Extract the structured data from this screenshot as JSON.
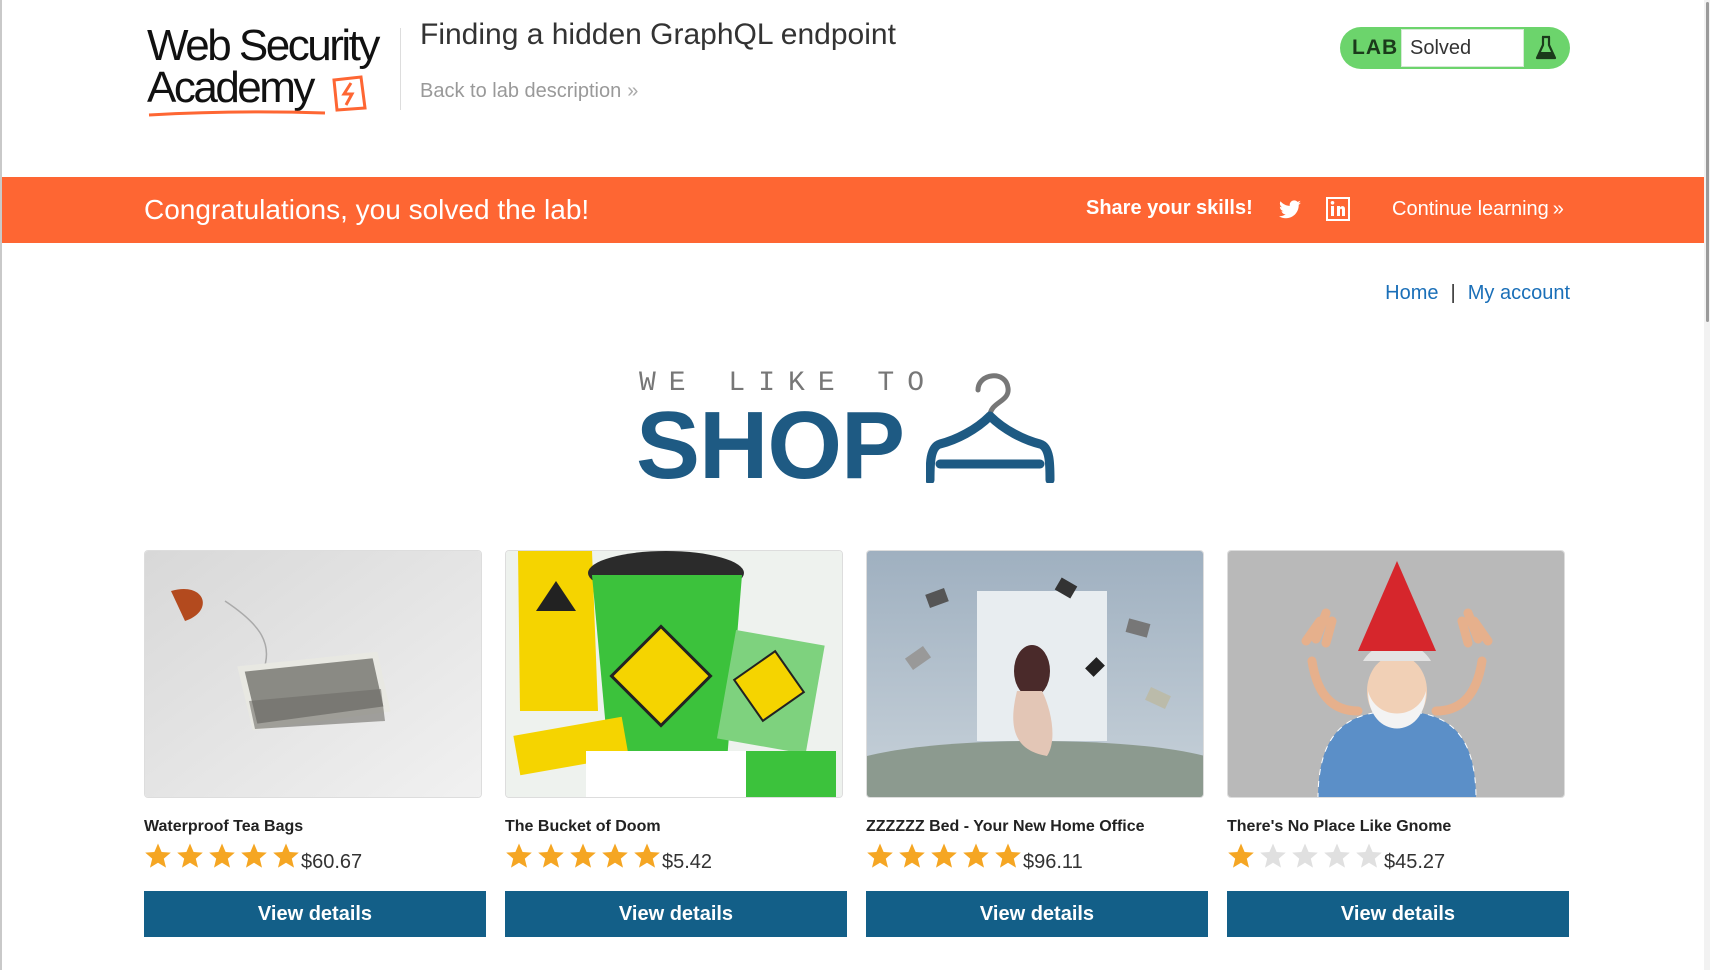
{
  "header": {
    "logo_line1": "Web Security",
    "logo_line2": "Academy",
    "lab_title": "Finding a hidden GraphQL endpoint",
    "back_link": "Back to lab description",
    "lab_badge": {
      "label": "LAB",
      "status": "Solved",
      "color": "#6cd46c"
    }
  },
  "banner": {
    "message": "Congratulations, you solved the lab!",
    "share_label": "Share your skills!",
    "continue_label": "Continue learning",
    "color": "#fe6633",
    "icons": [
      "twitter-icon",
      "linkedin-icon"
    ]
  },
  "nav": {
    "home": "Home",
    "separator": "|",
    "account": "My account"
  },
  "shop_logo": {
    "tagline": "WE LIKE TO",
    "word": "SHOP",
    "color": "#1e5a83"
  },
  "products": [
    {
      "name": "Waterproof Tea Bags",
      "rating": 5,
      "price": "$60.67",
      "button": "View details"
    },
    {
      "name": "The Bucket of Doom",
      "rating": 5,
      "price": "$5.42",
      "button": "View details"
    },
    {
      "name": "ZZZZZZ Bed - Your New Home Office",
      "rating": 5,
      "price": "$96.11",
      "button": "View details"
    },
    {
      "name": "There's No Place Like Gnome",
      "rating": 1,
      "price": "$45.27",
      "button": "View details"
    }
  ],
  "colors": {
    "button": "#135f88",
    "link": "#1a6fb8",
    "star_on": "#f5a623",
    "star_off": "#e0e0e0"
  }
}
